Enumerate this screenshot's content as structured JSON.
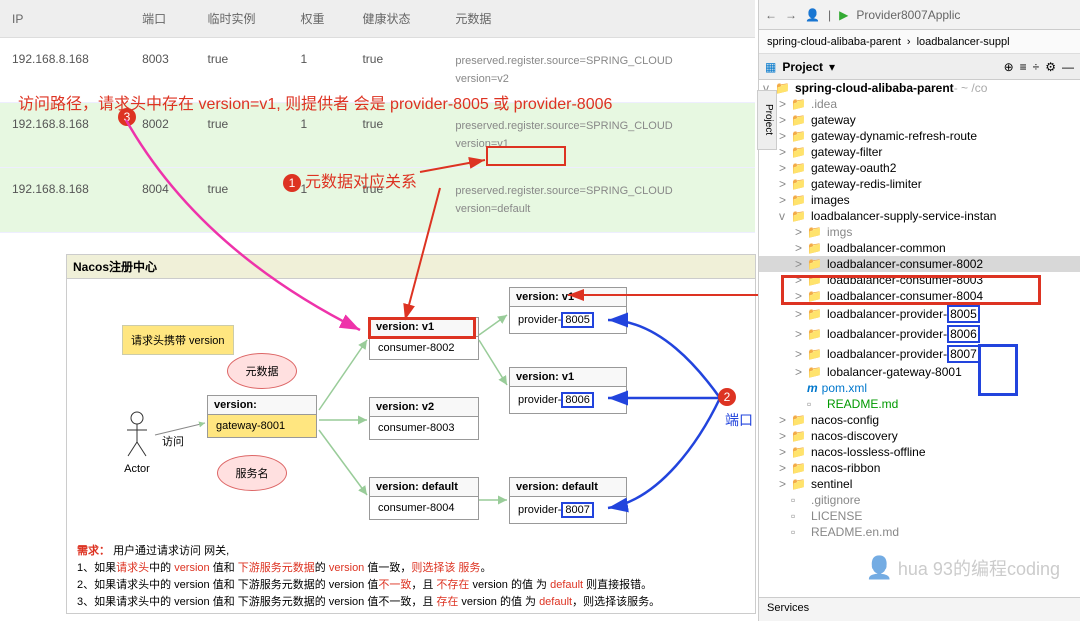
{
  "table": {
    "headers": [
      "IP",
      "端口",
      "临时实例",
      "权重",
      "健康状态",
      "元数据"
    ],
    "rows": [
      {
        "ip": "192.168.8.168",
        "port": "8003",
        "ephemeral": "true",
        "weight": "1",
        "health": "true",
        "meta": [
          "preserved.register.source=SPRING_CLOUD",
          "version=v2"
        ]
      },
      {
        "ip": "192.168.8.168",
        "port": "8002",
        "ephemeral": "true",
        "weight": "1",
        "health": "true",
        "meta": [
          "preserved.register.source=SPRING_CLOUD",
          "version=v1"
        ]
      },
      {
        "ip": "192.168.8.168",
        "port": "8004",
        "ephemeral": "true",
        "weight": "1",
        "health": "true",
        "meta": [
          "preserved.register.source=SPRING_CLOUD",
          "version=default"
        ]
      }
    ]
  },
  "annotations": {
    "path_text": "访问路径，请求头中存在 version=v1, 则提供者 会是 provider-8005 或 provider-8006",
    "meta_rel": "元数据对应关系",
    "port_label": "端口",
    "c1": "1",
    "c2": "2",
    "c3": "3"
  },
  "diagram": {
    "title": "Nacos注册中心",
    "request_note": "请求头携带 version",
    "meta_cloud": "元数据",
    "service_cloud": "服务名",
    "actor": "Actor",
    "visit": "访问",
    "gateway": {
      "ver": "version:",
      "name": "gateway-8001"
    },
    "consumers": [
      {
        "ver": "version: v1",
        "name": "consumer-8002"
      },
      {
        "ver": "version: v2",
        "name": "consumer-8003"
      },
      {
        "ver": "version: default",
        "name": "consumer-8004"
      }
    ],
    "providers": [
      {
        "ver": "version: v1",
        "name": "provider",
        "port": "8005"
      },
      {
        "ver": "version: v1",
        "name": "provider",
        "port": "8006"
      },
      {
        "ver": "version: default",
        "name": "provider",
        "port": "8007"
      }
    ]
  },
  "notes": {
    "title": "需求：",
    "intro": "用户通过请求访问 网关,",
    "l1a": "1、如果",
    "l1b": "请求头",
    "l1c": "中的 ",
    "l1d": "version",
    "l1e": " 值和 ",
    "l1f": "下游服务元数据",
    "l1g": "的 ",
    "l1h": "version",
    "l1i": " 值一致，",
    "l1j": "则选择该 服务",
    "l1k": "。",
    "l2": "2、如果请求头中的 version 值和 下游服务元数据的 version 值",
    "l2b": "不一致",
    "l2c": "，且 ",
    "l2d": "不存在",
    "l2e": " version 的值 为 ",
    "l2f": "default",
    "l2g": " 则直接报错。",
    "l3": "3、如果请求头中的 version 值和 下游服务元数据的 version 值不一致，且 ",
    "l3b": "存在",
    "l3c": " version 的值 为 ",
    "l3d": "default",
    "l3e": "，则选择该服务。"
  },
  "ide": {
    "run_config": "Provider8007Applic",
    "crumb1": "spring-cloud-alibaba-parent",
    "crumb2": "loadbalancer-suppl",
    "project": "Project",
    "root": "spring-cloud-alibaba-parent",
    "root_suffix": "~ /co",
    "tree": [
      {
        "d": 1,
        "a": ">",
        "ic": "📁",
        "n": ".idea",
        "c": "#888"
      },
      {
        "d": 1,
        "a": ">",
        "ic": "📁",
        "n": "gateway"
      },
      {
        "d": 1,
        "a": ">",
        "ic": "📁",
        "n": "gateway-dynamic-refresh-route"
      },
      {
        "d": 1,
        "a": ">",
        "ic": "📁",
        "n": "gateway-filter"
      },
      {
        "d": 1,
        "a": ">",
        "ic": "📁",
        "n": "gateway-oauth2"
      },
      {
        "d": 1,
        "a": ">",
        "ic": "📁",
        "n": "gateway-redis-limiter"
      },
      {
        "d": 1,
        "a": ">",
        "ic": "📁",
        "n": "images"
      },
      {
        "d": 1,
        "a": "v",
        "ic": "📁",
        "n": "loadbalancer-supply-service-instan"
      },
      {
        "d": 2,
        "a": ">",
        "ic": "📁",
        "n": "imgs",
        "c": "#888"
      },
      {
        "d": 2,
        "a": ">",
        "ic": "📁",
        "n": "loadbalancer-common"
      },
      {
        "d": 2,
        "a": ">",
        "ic": "📁",
        "n": "loadbalancer-consumer-8002",
        "sel": true
      },
      {
        "d": 2,
        "a": ">",
        "ic": "📁",
        "n": "loadbalancer-consumer-8003"
      },
      {
        "d": 2,
        "a": ">",
        "ic": "📁",
        "n": "loadbalancer-consumer-8004"
      },
      {
        "d": 2,
        "a": ">",
        "ic": "📁",
        "n": "loadbalancer-provider-",
        "p": "8005"
      },
      {
        "d": 2,
        "a": ">",
        "ic": "📁",
        "n": "loadbalancer-provider-",
        "p": "8006"
      },
      {
        "d": 2,
        "a": ">",
        "ic": "📁",
        "n": "loadbalancer-provider-",
        "p": "8007"
      },
      {
        "d": 2,
        "a": ">",
        "ic": "📁",
        "n": "lobalancer-gateway-8001"
      },
      {
        "d": 2,
        "a": "",
        "ic": "m",
        "n": "pom.xml",
        "c": "#07c"
      },
      {
        "d": 2,
        "a": "",
        "ic": "▫",
        "n": "README.md",
        "c": "#090"
      },
      {
        "d": 1,
        "a": ">",
        "ic": "📁",
        "n": "nacos-config"
      },
      {
        "d": 1,
        "a": ">",
        "ic": "📁",
        "n": "nacos-discovery"
      },
      {
        "d": 1,
        "a": ">",
        "ic": "📁",
        "n": "nacos-lossless-offline"
      },
      {
        "d": 1,
        "a": ">",
        "ic": "📁",
        "n": "nacos-ribbon"
      },
      {
        "d": 1,
        "a": ">",
        "ic": "📁",
        "n": "sentinel"
      },
      {
        "d": 1,
        "a": "",
        "ic": "▫",
        "n": ".gitignore",
        "c": "#888"
      },
      {
        "d": 1,
        "a": "",
        "ic": "▫",
        "n": "LICENSE",
        "c": "#888"
      },
      {
        "d": 1,
        "a": "",
        "ic": "▫",
        "n": "README.en.md",
        "c": "#888"
      }
    ],
    "services": "Services"
  },
  "watermark": "hua      93的编程coding"
}
